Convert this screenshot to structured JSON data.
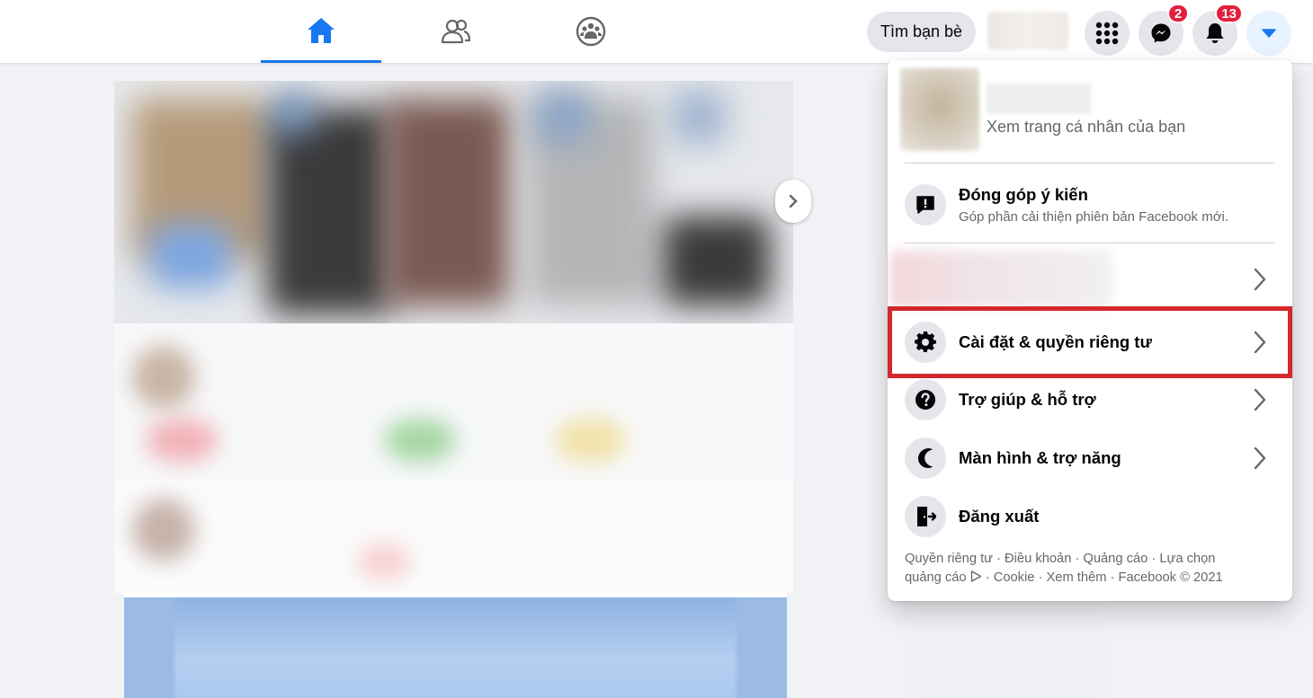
{
  "topbar": {
    "tabs": [
      {
        "name": "home",
        "icon": "home-icon",
        "active": true
      },
      {
        "name": "friends",
        "icon": "friends-icon",
        "active": false
      },
      {
        "name": "groups",
        "icon": "groups-icon",
        "active": false
      }
    ],
    "find_friends_label": "Tìm bạn bè",
    "messenger_badge": "2",
    "notifications_badge": "13",
    "accent_color": "#1877f2",
    "badge_color": "#e41e3f"
  },
  "dropdown": {
    "profile_sub": "Xem trang cá nhân của bạn",
    "feedback": {
      "title": "Đóng góp ý kiến",
      "subtitle": "Góp phần cải thiện phiên bản Facebook mới."
    },
    "items": [
      {
        "label": "Cài đặt & quyền riêng tư",
        "icon": "gear-icon",
        "has_chevron": true,
        "highlighted": true
      },
      {
        "label": "Trợ giúp & hỗ trợ",
        "icon": "question-icon",
        "has_chevron": true
      },
      {
        "label": "Màn hình & trợ năng",
        "icon": "moon-icon",
        "has_chevron": true
      },
      {
        "label": "Đăng xuất",
        "icon": "logout-icon",
        "has_chevron": false
      }
    ],
    "footer": {
      "line1": "Quyền riêng tư · Điều khoản · Quảng cáo · Lựa chọn",
      "line2_before_icon": "quảng cáo ",
      "line2_after_icon": " · Cookie · Xem thêm · Facebook © 2021"
    },
    "highlight_color": "#d3282d"
  }
}
